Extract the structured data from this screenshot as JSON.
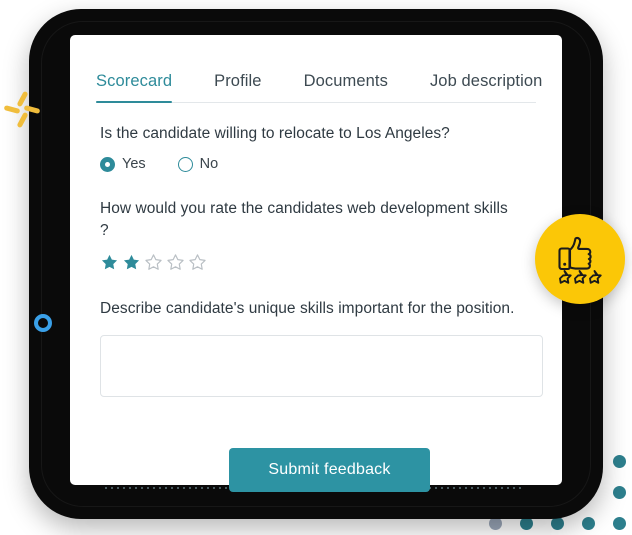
{
  "tabs": [
    {
      "label": "Scorecard",
      "active": true
    },
    {
      "label": "Profile",
      "active": false
    },
    {
      "label": "Documents",
      "active": false
    },
    {
      "label": "Job description",
      "active": false
    }
  ],
  "questions": {
    "relocate": {
      "text": "Is the candidate willing to relocate to Los Angeles?",
      "options": [
        {
          "label": "Yes",
          "selected": true
        },
        {
          "label": "No",
          "selected": false
        }
      ]
    },
    "rating": {
      "text": "How would you rate the candidates web development skills ?",
      "value": 2,
      "max": 5
    },
    "describe": {
      "text": "Describe candidate's unique skills important for the position.",
      "value": "",
      "placeholder": ""
    }
  },
  "submit": {
    "label": "Submit feedback"
  },
  "badge": {
    "icon": "thumbs-up-icon",
    "stars": 3
  },
  "colors": {
    "accent_teal": "#2e8b9a",
    "button_teal": "#2d93a3",
    "badge_yellow": "#fbc707",
    "pinwheel_yellow": "#f0bd3c",
    "ring_blue": "#3aa0e8",
    "dot_teal": "#2d7f8d",
    "frame_black": "#0a0a0a",
    "text_dark": "#2f3a42",
    "star_empty": "#b9bfc4"
  },
  "decorations": {
    "pinwheel": "pinwheel-icon",
    "ring": "ring-icon",
    "dot_grid_rows": 3,
    "dot_grid_cols": 5
  }
}
